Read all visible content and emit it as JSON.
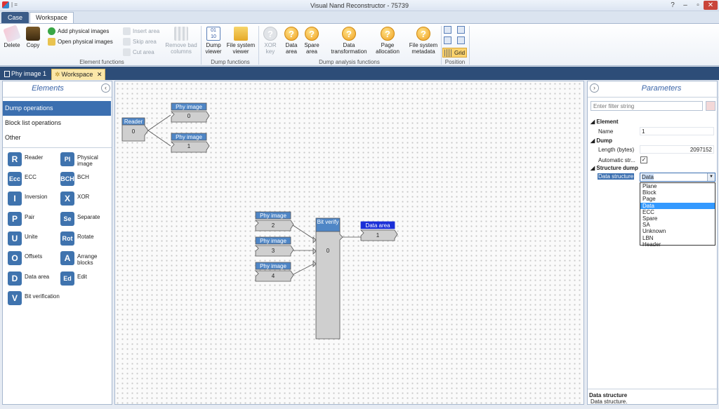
{
  "window": {
    "title": "Visual Nand Reconstructor - 75739",
    "quick_access": "| ="
  },
  "ribbon": {
    "tabs": [
      "Case",
      "Workspace"
    ],
    "groups": {
      "element": {
        "label": "Element functions",
        "delete": "Delete",
        "copy": "Copy",
        "add_physical": "Add physical images",
        "open_physical": "Open physical images",
        "insert_area": "Insert area",
        "skip_area": "Skip area",
        "cut_area": "Cut area",
        "remove_bad": "Remove bad columns"
      },
      "dump": {
        "label": "Dump functions",
        "dump_viewer": "Dump viewer",
        "fs_viewer": "File system viewer"
      },
      "analysis": {
        "label": "Dump analysis functions",
        "xor_key": "XOR key",
        "data_area": "Data area",
        "spare_area": "Spare area",
        "data_transformation": "Data transformation",
        "page_allocation": "Page allocation",
        "fs_metadata": "File system metadata"
      },
      "position": {
        "label": "Position",
        "grid": "Grid"
      }
    }
  },
  "doc_tabs": [
    "Phy image 1",
    "Workspace"
  ],
  "left_panel": {
    "title": "Elements",
    "categories": [
      "Dump operations",
      "Block list operations",
      "Other"
    ],
    "elements": [
      {
        "badge": "R",
        "label": "Reader"
      },
      {
        "badge": "PI",
        "label": "Physical image"
      },
      {
        "badge": "Ecc",
        "label": "ECC"
      },
      {
        "badge": "BCH",
        "label": "BCH"
      },
      {
        "badge": "I",
        "label": "Inversion"
      },
      {
        "badge": "X",
        "label": "XOR"
      },
      {
        "badge": "P",
        "label": "Pair"
      },
      {
        "badge": "Se",
        "label": "Separate"
      },
      {
        "badge": "U",
        "label": "Unite"
      },
      {
        "badge": "Rot",
        "label": "Rotate"
      },
      {
        "badge": "O",
        "label": "Offsets"
      },
      {
        "badge": "A",
        "label": "Arrange blocks"
      },
      {
        "badge": "D",
        "label": "Data area"
      },
      {
        "badge": "Ed",
        "label": "Edit"
      },
      {
        "badge": "V",
        "label": "Bit verification"
      }
    ]
  },
  "canvas": {
    "nodes": {
      "reader": {
        "title": "Reader",
        "value": "0"
      },
      "phy0": {
        "title": "Phy image",
        "value": "0"
      },
      "phy1": {
        "title": "Phy image",
        "value": "1"
      },
      "phy2": {
        "title": "Phy image",
        "value": "2"
      },
      "phy3": {
        "title": "Phy image",
        "value": "3"
      },
      "phy4": {
        "title": "Phy image",
        "value": "4"
      },
      "bitverify": {
        "title": "Bit verify",
        "value": "0"
      },
      "dataarea": {
        "title": "Data area",
        "value": "1"
      }
    }
  },
  "right_panel": {
    "title": "Parameters",
    "filter_placeholder": "Enter filter string",
    "sections": {
      "element": {
        "label": "Element",
        "name_label": "Name",
        "name_value": "1"
      },
      "dump": {
        "label": "Dump",
        "length_label": "Length (bytes)",
        "length_value": "2097152",
        "auto_label": "Automatic str...",
        "auto_checked": "✓"
      },
      "structure": {
        "label": "Structure dump",
        "ds_label": "Data structure",
        "ds_value": "Data"
      }
    },
    "dropdown_options": [
      "Plane",
      "Block",
      "Page",
      "Data",
      "ECC",
      "Spare",
      "SA",
      "Unknown",
      "LBN",
      "Header"
    ],
    "dropdown_selected": "Data",
    "footer": {
      "title": "Data structure",
      "desc": "Data structure."
    }
  },
  "colors": {
    "accent": "#3b6fb0",
    "badge": "#3f73ae",
    "node_selected": "#1a2fd8",
    "node_header": "#4f86c6"
  }
}
